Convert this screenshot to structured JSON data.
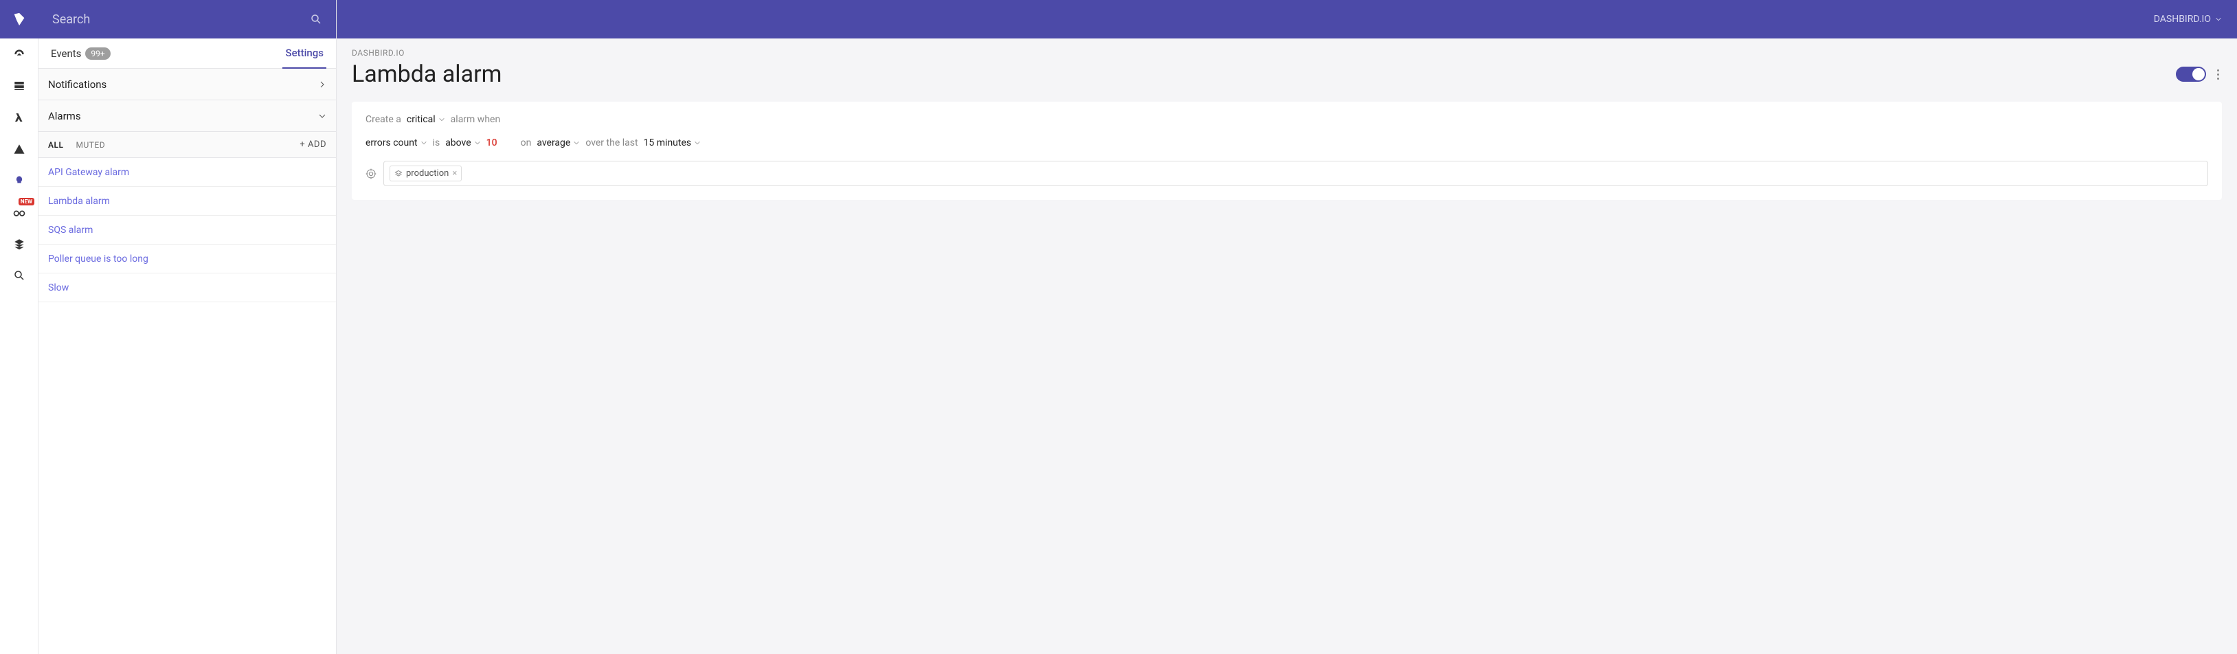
{
  "header": {
    "search_placeholder": "Search",
    "org_name": "DASHBIRD.IO"
  },
  "rail": {
    "new_badge": "NEW"
  },
  "sidebar": {
    "tabs": {
      "events_label": "Events",
      "events_count": "99+",
      "settings_label": "Settings"
    },
    "sections": {
      "notifications": "Notifications",
      "alarms": "Alarms"
    },
    "filters": {
      "all": "ALL",
      "muted": "MUTED",
      "add": "+ ADD"
    },
    "alarms": [
      "API Gateway alarm",
      "Lambda alarm",
      "SQS alarm",
      "Poller queue is too long",
      "Slow"
    ]
  },
  "main": {
    "breadcrumb": "DASHBIRD.IO",
    "title": "Lambda alarm",
    "line1": {
      "create_a": "Create a",
      "severity": "critical",
      "alarm_when": "alarm when"
    },
    "line2": {
      "metric": "errors count",
      "is": "is",
      "comparator": "above",
      "threshold": "10",
      "on": "on",
      "agg": "average",
      "over": "over the last",
      "window": "15 minutes"
    },
    "target_tag": "production"
  }
}
